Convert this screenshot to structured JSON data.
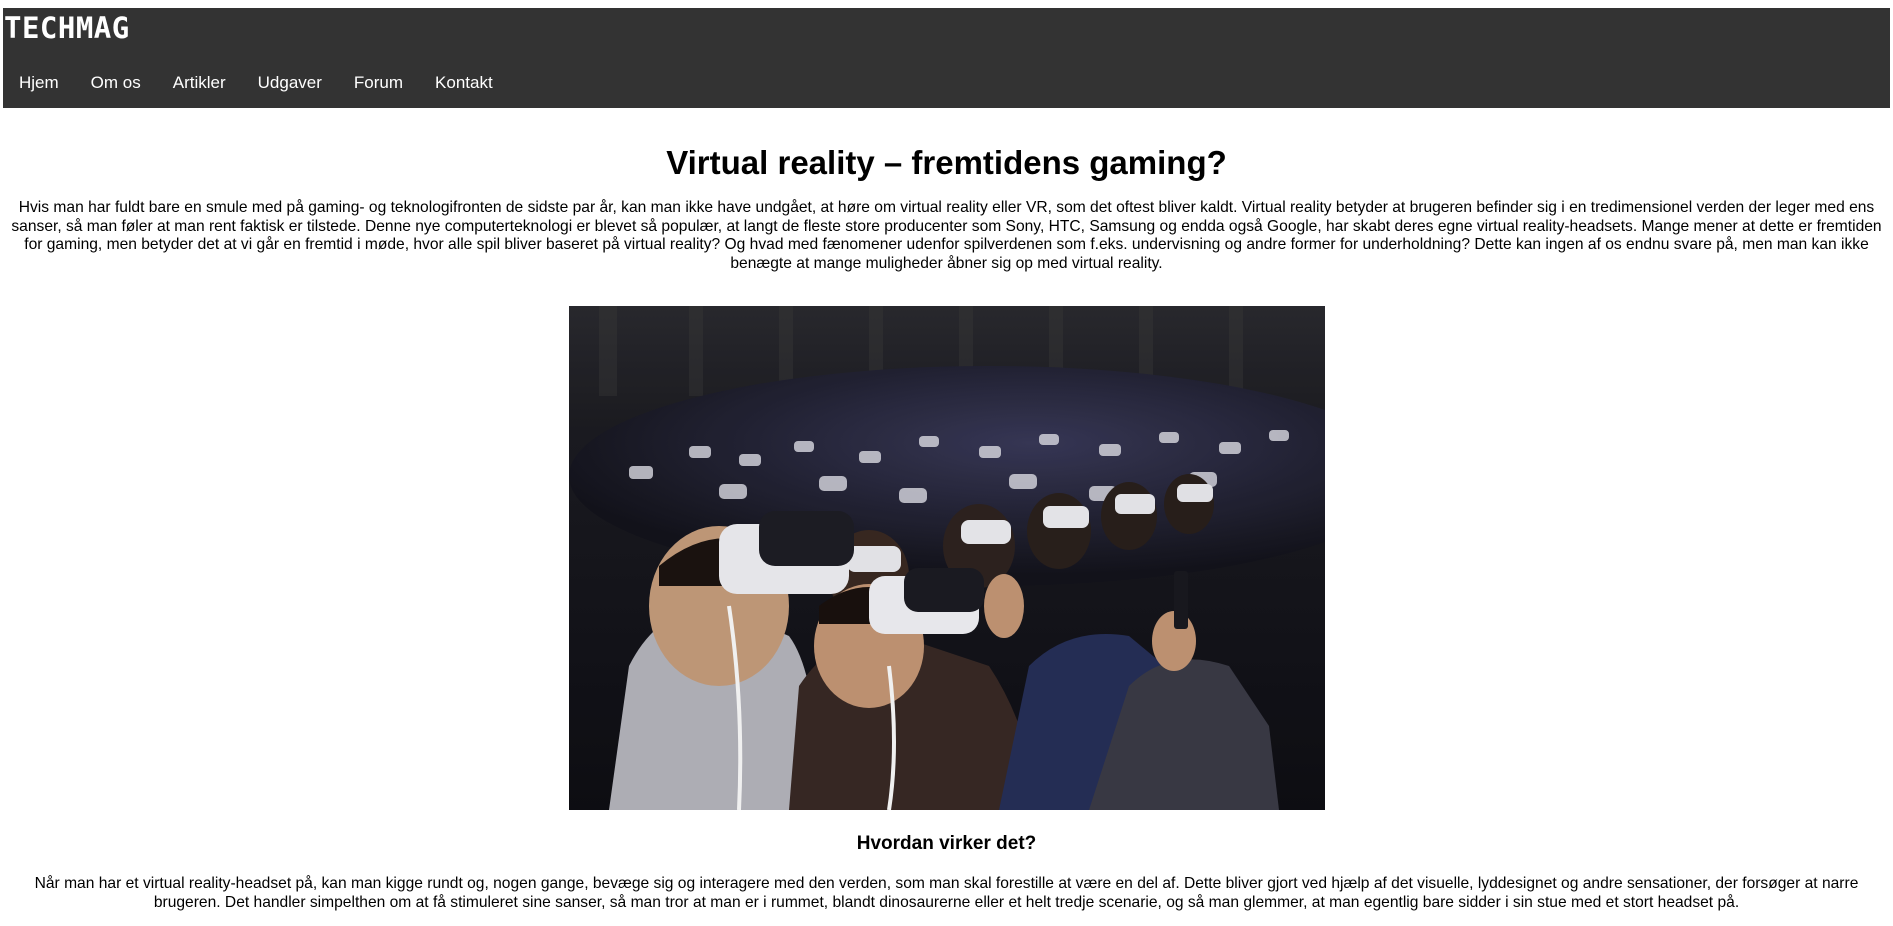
{
  "header": {
    "logo": "TECHMAG",
    "background_color": "#333333",
    "nav": [
      {
        "label": "Hjem"
      },
      {
        "label": "Om os"
      },
      {
        "label": "Artikler"
      },
      {
        "label": "Udgaver"
      },
      {
        "label": "Forum"
      },
      {
        "label": "Kontakt"
      }
    ]
  },
  "article": {
    "title": "Virtual reality – fremtidens gaming?",
    "intro": "Hvis man har fuldt bare en smule med på gaming- og teknologifronten de sidste par år, kan man ikke have undgået, at høre om virtual reality eller VR, som det oftest bliver kaldt. Virtual reality betyder at brugeren befinder sig i en tredimensionel verden der leger med ens sanser, så man føler at man rent faktisk er tilstede. Denne nye computerteknologi er blevet så populær, at langt de fleste store producenter som Sony, HTC, Samsung og endda også Google, har skabt deres egne virtual reality-headsets. Mange mener at dette er fremtiden for gaming, men betyder det at vi går en fremtid i møde, hvor alle spil bliver baseret på virtual reality? Og hvad med fænomener udenfor spilverdenen som f.eks. undervisning og andre former for underholdning? Dette kan ingen af os endnu svare på, men man kan ikke benægte at mange muligheder åbner sig op med virtual reality.",
    "image_subject": "audience-wearing-vr-headsets-photo",
    "subheading": "Hvordan virker det?",
    "body": "Når man har et virtual reality-headset på, kan man kigge rundt og, nogen gange, bevæge sig og interagere med den verden, som man skal forestille at være en del af. Dette bliver gjort ved hjælp af det visuelle, lyddesignet og andre sensationer, der forsøger at narre brugeren. Det handler simpelthen om at få stimuleret sine sanser, så man tror at man er i rummet, blandt dinosaurerne eller et helt tredje scenarie, og så man glemmer, at man egentlig bare sidder i sin stue med et stort headset på."
  }
}
